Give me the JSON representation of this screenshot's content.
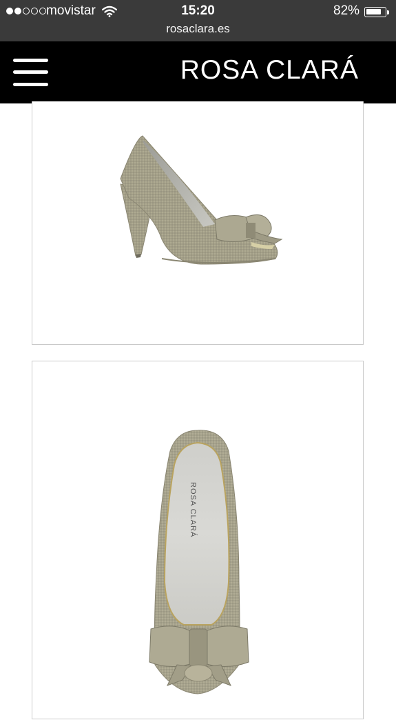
{
  "status_bar": {
    "signal_strength": 2,
    "signal_total": 5,
    "carrier": "movistar",
    "wifi_icon": "wifi-icon",
    "time": "15:20",
    "battery_percent": "82%",
    "battery_level": 0.82,
    "url": "rosaclara.es"
  },
  "header": {
    "menu_icon": "hamburger-menu-icon",
    "brand": "ROSA CLARÁ"
  },
  "products": [
    {
      "image": "shoe-side-view"
    },
    {
      "image": "shoe-top-view",
      "insole_text": "ROSA CLARÁ"
    }
  ],
  "colors": {
    "status_bg": "#3a3a3a",
    "header_bg": "#000000",
    "shoe_fabric": "#a39f87",
    "card_border": "#c9c9c9"
  }
}
